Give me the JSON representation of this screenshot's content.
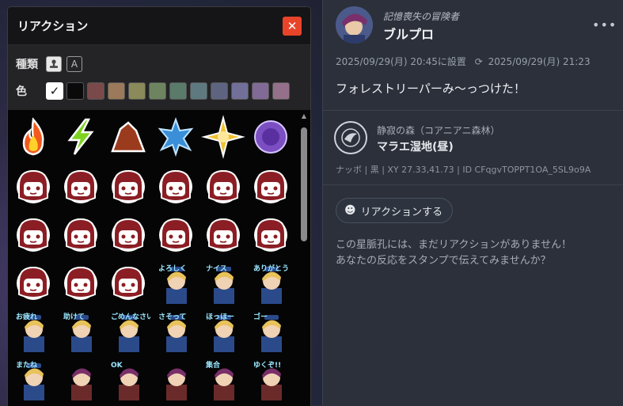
{
  "panel": {
    "title": "リアクション",
    "close_icon": "✕",
    "type_label": "種類",
    "type_buttons": [
      {
        "name": "stamp",
        "glyph": "⚑",
        "active": true
      },
      {
        "name": "text",
        "glyph": "A",
        "active": false
      }
    ],
    "color_label": "色",
    "colors": [
      "#ffffff",
      "#0a0a0a",
      "#7a4a4a",
      "#9a7a5a",
      "#8a8a5a",
      "#6e8460",
      "#5a7a6a",
      "#5e7a80",
      "#5e6480",
      "#727098",
      "#826a96",
      "#94708a"
    ],
    "selected_color_check": "✓",
    "stickers": [
      {
        "name": "fire"
      },
      {
        "name": "lightning"
      },
      {
        "name": "rock"
      },
      {
        "name": "ice-star"
      },
      {
        "name": "light-star"
      },
      {
        "name": "dark-orb"
      },
      {
        "name": "face-surprise"
      },
      {
        "name": "face-confused"
      },
      {
        "name": "face-angry"
      },
      {
        "name": "face-crown"
      },
      {
        "name": "face-annoyed"
      },
      {
        "name": "face-shocked"
      },
      {
        "name": "face-steam"
      },
      {
        "name": "face-wonder"
      },
      {
        "name": "face-grin"
      },
      {
        "name": "face-love"
      },
      {
        "name": "face-happy"
      },
      {
        "name": "face-sweat"
      },
      {
        "name": "face-halo"
      },
      {
        "name": "face-shock2"
      },
      {
        "name": "face-heart"
      },
      {
        "name": "chara-yoroshiku",
        "text": "よろしく"
      },
      {
        "name": "chara-nice",
        "text": "ナイス"
      },
      {
        "name": "chara-arigatou",
        "text": "ありがとう"
      },
      {
        "name": "chara-otsukare",
        "text": "お疲れ"
      },
      {
        "name": "chara-tasukete",
        "text": "助けて"
      },
      {
        "name": "chara-gomen",
        "text": "ごめんなさい"
      },
      {
        "name": "chara-sasotte",
        "text": "さそって"
      },
      {
        "name": "chara-hoi",
        "text": "ほっほー"
      },
      {
        "name": "chara-go",
        "text": "ゴー"
      },
      {
        "name": "chara-mattane",
        "text": "またね"
      },
      {
        "name": "chara-girl1",
        "text": ""
      },
      {
        "name": "chara-ok",
        "text": "OK"
      },
      {
        "name": "chara-girl2",
        "text": ""
      },
      {
        "name": "chara-meeting",
        "text": "集合"
      },
      {
        "name": "chara-yukuzo",
        "text": "ゆくぞ!!"
      }
    ]
  },
  "post": {
    "author_subtitle": "記憶喪失の冒険者",
    "author_name": "ブルプロ",
    "more": "•••",
    "set_time": "2025/09/29(月) 20:45に設置",
    "updated_time": "2025/09/29(月) 21:23",
    "refresh_icon": "⟳",
    "text": "フォレストリーパーみ〜っつけた！",
    "location_area": "静寂の森（コアニアニ森林）",
    "location_name": "マラエ湿地(昼)",
    "location_meta": "ナッボ | 黒 | XY 27.33,41.73 | ID CFqgvTOPPT1OA_5SL9o9A",
    "react_icon": "☻",
    "react_label": "リアクションする",
    "empty_line1": "この星脈孔には、まだリアクションがありません！",
    "empty_line2": "あなたの反応をスタンプで伝えてみませんか？"
  }
}
